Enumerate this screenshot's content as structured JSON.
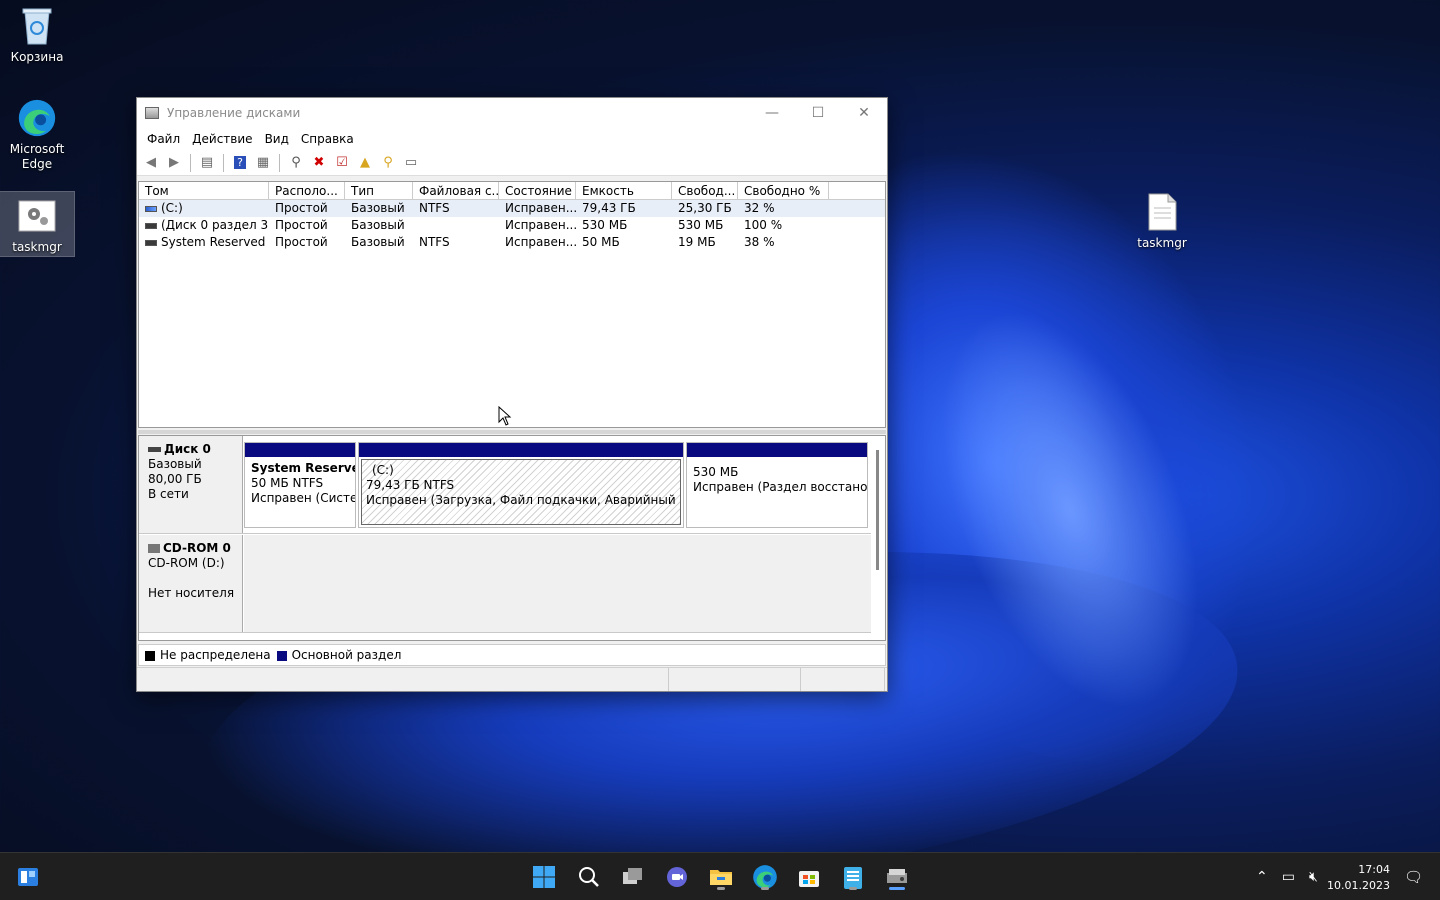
{
  "desktop": {
    "icons": [
      {
        "label": "Корзина",
        "icon": "recycle-bin-icon"
      },
      {
        "label": "Microsoft Edge",
        "icon": "edge-icon"
      },
      {
        "label": "taskmgr",
        "icon": "shortcut-gear-icon"
      },
      {
        "label": "taskmgr",
        "icon": "text-file-icon"
      }
    ]
  },
  "window": {
    "title": "Управление дисками",
    "menu": [
      "Файл",
      "Действие",
      "Вид",
      "Справка"
    ],
    "columns": [
      "Том",
      "Располо...",
      "Тип",
      "Файловая с...",
      "Состояние",
      "Емкость",
      "Свобод...",
      "Свободно %"
    ],
    "volumes": [
      {
        "name": "(C:)",
        "layout": "Простой",
        "type": "Базовый",
        "fs": "NTFS",
        "status": "Исправен...",
        "capacity": "79,43 ГБ",
        "free": "25,30 ГБ",
        "free_pct": "32 %"
      },
      {
        "name": "(Диск 0 раздел 3)",
        "layout": "Простой",
        "type": "Базовый",
        "fs": "",
        "status": "Исправен...",
        "capacity": "530 МБ",
        "free": "530 МБ",
        "free_pct": "100 %"
      },
      {
        "name": "System Reserved",
        "layout": "Простой",
        "type": "Базовый",
        "fs": "NTFS",
        "status": "Исправен...",
        "capacity": "50 МБ",
        "free": "19 МБ",
        "free_pct": "38 %"
      }
    ],
    "disks": [
      {
        "name": "Диск 0",
        "type": "Базовый",
        "size": "80,00 ГБ",
        "state": "В сети",
        "partitions": [
          {
            "title": "System Reserved",
            "size": "50 МБ NTFS",
            "status": "Исправен (Систем"
          },
          {
            "title": "(C:)",
            "size": "79,43 ГБ NTFS",
            "status": "Исправен (Загрузка, Файл подкачки, Аварийный дамп па"
          },
          {
            "title": "",
            "size": "530 МБ",
            "status": "Исправен (Раздел восстановле"
          }
        ]
      },
      {
        "name": "CD-ROM 0",
        "type": "CD-ROM (D:)",
        "state": "Нет носителя"
      }
    ],
    "legend": [
      {
        "label": "Не распределена",
        "color": "#000000"
      },
      {
        "label": "Основной раздел",
        "color": "#0a0a80"
      }
    ]
  },
  "taskbar": {
    "time": "17:04",
    "date": "10.01.2023"
  }
}
